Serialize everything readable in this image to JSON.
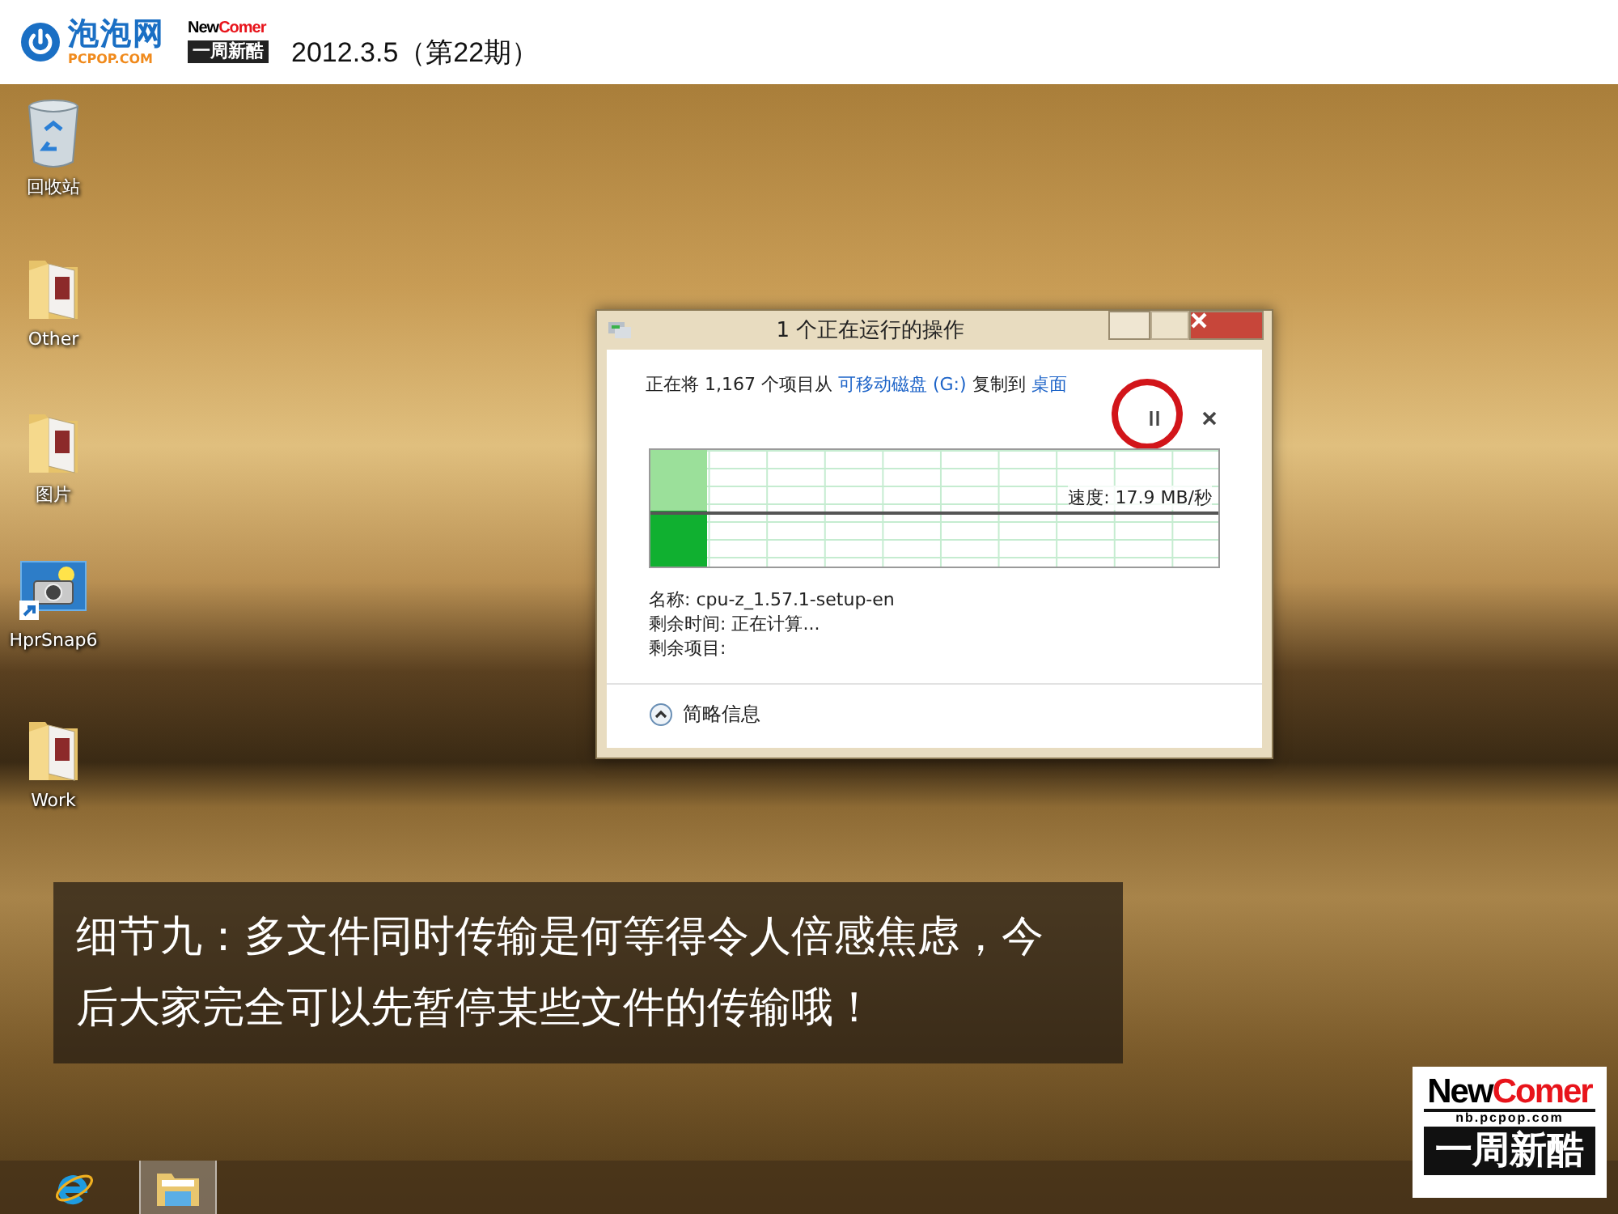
{
  "header": {
    "logo_name": "泡泡网",
    "logo_domain": "PCPOP.COM",
    "badge_top": "New",
    "badge_top_accent": "Comer",
    "badge_bottom": "一周新酷",
    "issue": "2012.3.5（第22期）"
  },
  "desktop_icons": [
    {
      "label": "回收站",
      "kind": "recycle"
    },
    {
      "label": "Other",
      "kind": "folder"
    },
    {
      "label": "图片",
      "kind": "folder"
    },
    {
      "label": "HprSnap6",
      "kind": "app"
    },
    {
      "label": "Work",
      "kind": "folder"
    }
  ],
  "dialog": {
    "title": "1 个正在运行的操作",
    "summary_prefix": "正在将 1,167 个项目从",
    "source_link": "可移动磁盘 (G:)",
    "summary_middle": "复制到",
    "destination_link": "桌面",
    "level": 0.1,
    "speed": "速度: 17.9 MB/秒",
    "details": [
      {
        "label": "名称:",
        "value": "cpu-z_1.57.1-setup-en"
      },
      {
        "label": "剩余时间:",
        "value": "正在计算..."
      },
      {
        "label": "剩余项目:"
      }
    ],
    "toggle": "简略信息"
  },
  "caption": "细节九：多文件同时传输是何等得令人倍感焦虑，今后大家完全可以先暂停某些文件的传输哦！",
  "corner_logo": {
    "top": "New",
    "top_accent": "Comer",
    "domain": "nb.pcpop.com",
    "bottom": "一周新酷"
  },
  "taskbar": {
    "items": [
      {
        "kind": "browser",
        "selected": false
      },
      {
        "kind": "explorer",
        "selected": true
      }
    ]
  }
}
